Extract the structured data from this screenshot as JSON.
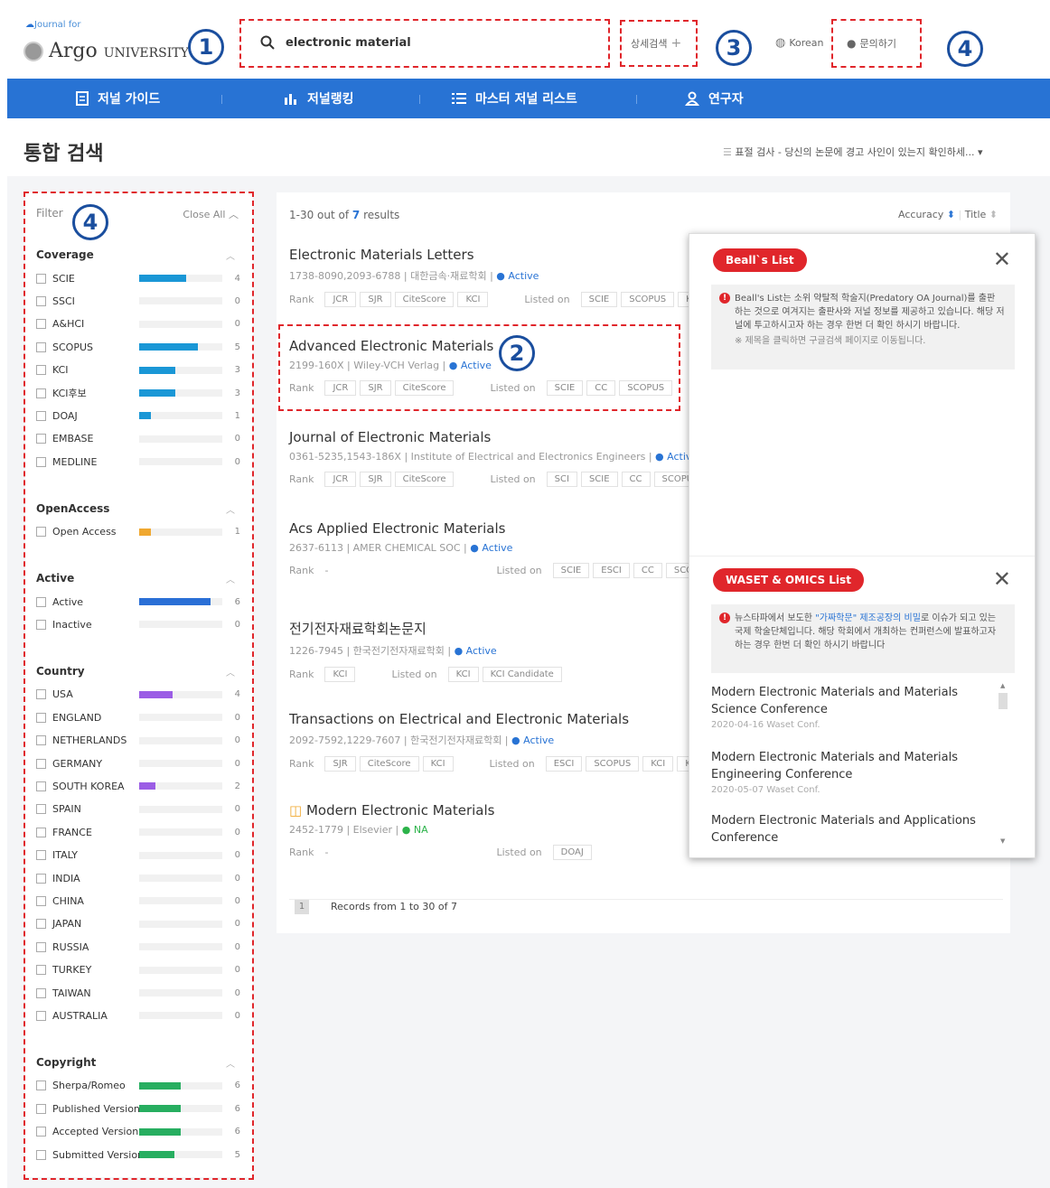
{
  "header": {
    "logo_small": "Journal for",
    "logo_brand": "Argo",
    "logo_sub": "UNIVERSITY",
    "search_value": "electronic material",
    "advanced_search": "상세검색",
    "language": "Korean",
    "inquiry": "문의하기"
  },
  "callouts": {
    "c1": "1",
    "c2": "2",
    "c3": "3",
    "c4": "4"
  },
  "nav": [
    {
      "label": "저널 가이드",
      "icon": "document-icon"
    },
    {
      "label": "저널랭킹",
      "icon": "bar-chart-icon"
    },
    {
      "label": "마스터 저널 리스트",
      "icon": "list-icon"
    },
    {
      "label": "연구자",
      "icon": "user-icon"
    }
  ],
  "page_title": "통합 검색",
  "notice": "표절 검사 - 당신의 논문에 경고 사인이 있는지 확인하세...",
  "filter": {
    "title": "Filter",
    "close_all": "Close All",
    "sections": [
      {
        "name": "Coverage",
        "color": "#1a97d6",
        "rows": [
          {
            "label": "SCIE",
            "count": "4",
            "level": 0.57
          },
          {
            "label": "SSCI",
            "count": "0",
            "level": 0
          },
          {
            "label": "A&HCI",
            "count": "0",
            "level": 0
          },
          {
            "label": "SCOPUS",
            "count": "5",
            "level": 0.71
          },
          {
            "label": "KCI",
            "count": "3",
            "level": 0.43
          },
          {
            "label": "KCI후보",
            "count": "3",
            "level": 0.43
          },
          {
            "label": "DOAJ",
            "count": "1",
            "level": 0.14
          },
          {
            "label": "EMBASE",
            "count": "0",
            "level": 0
          },
          {
            "label": "MEDLINE",
            "count": "0",
            "level": 0
          }
        ]
      },
      {
        "name": "OpenAccess",
        "color": "#f0a830",
        "rows": [
          {
            "label": "Open Access",
            "count": "1",
            "level": 0.14
          }
        ]
      },
      {
        "name": "Active",
        "color": "#2a6fd6",
        "rows": [
          {
            "label": "Active",
            "count": "6",
            "level": 0.86
          },
          {
            "label": "Inactive",
            "count": "0",
            "level": 0
          }
        ]
      },
      {
        "name": "Country",
        "color": "#9b5de5",
        "rows": [
          {
            "label": "USA",
            "count": "4",
            "level": 0.4
          },
          {
            "label": "ENGLAND",
            "count": "0",
            "level": 0
          },
          {
            "label": "NETHERLANDS",
            "count": "0",
            "level": 0
          },
          {
            "label": "GERMANY",
            "count": "0",
            "level": 0
          },
          {
            "label": "SOUTH KOREA",
            "count": "2",
            "level": 0.2
          },
          {
            "label": "SPAIN",
            "count": "0",
            "level": 0
          },
          {
            "label": "FRANCE",
            "count": "0",
            "level": 0
          },
          {
            "label": "ITALY",
            "count": "0",
            "level": 0
          },
          {
            "label": "INDIA",
            "count": "0",
            "level": 0
          },
          {
            "label": "CHINA",
            "count": "0",
            "level": 0
          },
          {
            "label": "JAPAN",
            "count": "0",
            "level": 0
          },
          {
            "label": "RUSSIA",
            "count": "0",
            "level": 0
          },
          {
            "label": "TURKEY",
            "count": "0",
            "level": 0
          },
          {
            "label": "TAIWAN",
            "count": "0",
            "level": 0
          },
          {
            "label": "AUSTRALIA",
            "count": "0",
            "level": 0
          }
        ]
      },
      {
        "name": "Copyright",
        "color": "#27ae60",
        "rows": [
          {
            "label": "Sherpa/Romeo",
            "count": "6",
            "level": 0.5
          },
          {
            "label": "Published Version",
            "count": "6",
            "level": 0.5
          },
          {
            "label": "Accepted Version",
            "count": "6",
            "level": 0.5
          },
          {
            "label": "Submitted Version",
            "count": "5",
            "level": 0.42
          }
        ]
      }
    ]
  },
  "results": {
    "summary_pre": "1-30 out of",
    "summary_count": "7",
    "summary_post": "results",
    "sort_accuracy": "Accuracy",
    "sort_title": "Title",
    "items": [
      {
        "title": "Electronic Materials Letters",
        "meta": "1738-8090,2093-6788 | 대한금속·재료학회 |",
        "status": "Active",
        "status_type": "act",
        "ranks": [
          "JCR",
          "SJR",
          "CiteScore",
          "KCI"
        ],
        "listed": [
          "SCIE",
          "SCOPUS",
          "KCI"
        ],
        "oa": false
      },
      {
        "title": "Advanced Electronic Materials",
        "meta": "2199-160X | Wiley-VCH Verlag |",
        "status": "Active",
        "status_type": "act",
        "ranks": [
          "JCR",
          "SJR",
          "CiteScore"
        ],
        "listed": [
          "SCIE",
          "CC",
          "SCOPUS"
        ],
        "oa": false
      },
      {
        "title": "Journal of Electronic Materials",
        "meta": "0361-5235,1543-186X | Institute of Electrical and Electronics Engineers |",
        "status": "Active",
        "status_type": "act",
        "ranks": [
          "JCR",
          "SJR",
          "CiteScore"
        ],
        "listed": [
          "SCI",
          "SCIE",
          "CC",
          "SCOPUS"
        ],
        "oa": false
      },
      {
        "title": "Acs Applied Electronic Materials",
        "meta": "2637-6113 | AMER CHEMICAL SOC |",
        "status": "Active",
        "status_type": "act",
        "ranks": [],
        "rank_dash": "-",
        "listed": [
          "SCIE",
          "ESCI",
          "CC",
          "SCOPUS"
        ],
        "oa": false
      },
      {
        "title": "전기전자재료학회논문지",
        "meta": "1226-7945 | 한국전기전자재료학회 |",
        "status": "Active",
        "status_type": "act",
        "ranks": [
          "KCI"
        ],
        "listed": [
          "KCI",
          "KCI Candidate"
        ],
        "oa": false
      },
      {
        "title": "Transactions on Electrical and Electronic Materials",
        "meta": "2092-7592,1229-7607 | 한국전기전자재료학회 |",
        "status": "Active",
        "status_type": "act",
        "ranks": [
          "SJR",
          "CiteScore",
          "KCI"
        ],
        "listed": [
          "ESCI",
          "SCOPUS",
          "KCI",
          "KCI"
        ],
        "oa": false
      },
      {
        "title": "Modern Electronic Materials",
        "meta": "2452-1779 | Elsevier |",
        "status": "NA",
        "status_type": "na",
        "ranks": [],
        "rank_dash": "-",
        "listed": [
          "DOAJ"
        ],
        "oa": true
      }
    ],
    "rank_label": "Rank",
    "listed_label": "Listed on",
    "page_number": "1",
    "records": "Records from 1 to 30 of 7"
  },
  "popup": {
    "bealls_title": "Beall`s List",
    "bealls_text": "Beall's List는 소위 약탈적 학술지(Predatory OA Journal)를 출판 하는 것으로 여겨지는 출판사와 저널 정보를 제공하고 있습니다. 해당 저널에 투고하시고자 하는 경우 한번 더 확인 하시기 바랍니다.",
    "bealls_sub": "※ 제목을 클릭하면 구글검색 페이지로 이동됩니다.",
    "waset_title": "WASET & OMICS List",
    "waset_pre": "뉴스타파에서 보도한",
    "waset_link": "\"가짜학문\" 제조공장의 비밀",
    "waset_post": "로 이슈가 되고 있는 국제 학술단체입니다. 해당 학회에서 개최하는 컨퍼런스에 발표하고자 하는 경우 한번 더 확인 하시기 바랍니다",
    "conferences": [
      {
        "title": "Modern Electronic Materials and Materials Science Conference",
        "date": "2020-04-16 Waset Conf."
      },
      {
        "title": "Modern Electronic Materials and Materials Engineering Conference",
        "date": "2020-05-07 Waset Conf."
      },
      {
        "title": "Modern Electronic Materials and Applications Conference",
        "date": ""
      }
    ]
  }
}
